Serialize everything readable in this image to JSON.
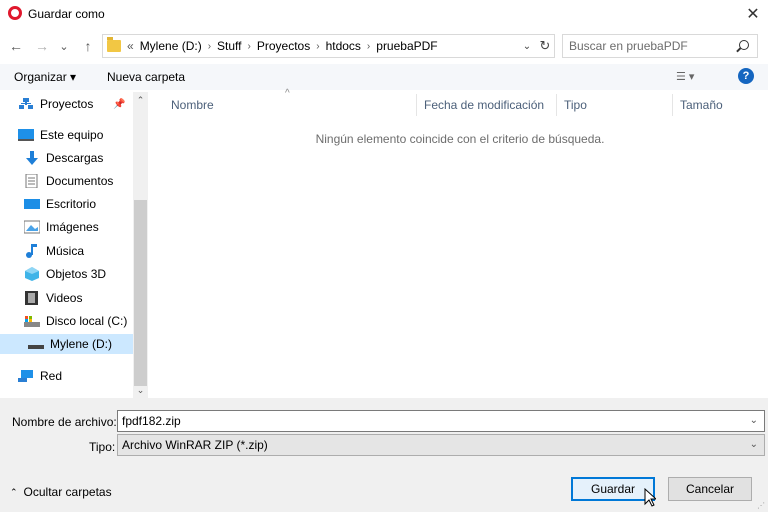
{
  "window": {
    "title": "Guardar como"
  },
  "nav": {
    "back": "←",
    "forward": "→",
    "recent": "⌄",
    "up": "↑"
  },
  "address": {
    "overflow": "«",
    "crumbs": [
      "Mylene (D:)",
      "Stuff",
      "Proyectos",
      "htdocs",
      "pruebaPDF"
    ]
  },
  "search": {
    "placeholder": "Buscar en pruebaPDF"
  },
  "toolbar": {
    "organize": "Organizar ▾",
    "new_folder": "Nueva carpeta",
    "help": "?"
  },
  "sidebar": {
    "items": [
      {
        "label": "Proyectos",
        "icon": "network-folder-icon"
      },
      {
        "label": "Este equipo",
        "icon": "computer-icon"
      },
      {
        "label": "Descargas",
        "icon": "downloads-icon"
      },
      {
        "label": "Documentos",
        "icon": "documents-icon"
      },
      {
        "label": "Escritorio",
        "icon": "desktop-icon"
      },
      {
        "label": "Imágenes",
        "icon": "pictures-icon"
      },
      {
        "label": "Música",
        "icon": "music-icon"
      },
      {
        "label": "Objetos 3D",
        "icon": "objects3d-icon"
      },
      {
        "label": "Videos",
        "icon": "videos-icon"
      },
      {
        "label": "Disco local (C:)",
        "icon": "local-disk-icon"
      },
      {
        "label": "Mylene (D:)",
        "icon": "drive-icon",
        "selected": true
      },
      {
        "label": "Red",
        "icon": "network-icon"
      }
    ]
  },
  "columns": [
    "Nombre",
    "Fecha de modificación",
    "Tipo",
    "Tamaño"
  ],
  "empty_message": "Ningún elemento coincide con el criterio de búsqueda.",
  "form": {
    "filename_label": "Nombre de archivo:",
    "filename_value": "fpdf182.zip",
    "type_label": "Tipo:",
    "type_value": "Archivo WinRAR ZIP (*.zip)"
  },
  "footer": {
    "hide_folders": "Ocultar carpetas",
    "save": "Guardar",
    "cancel": "Cancelar"
  },
  "colors": {
    "accent": "#0078d7",
    "selected": "#cce8ff",
    "brand": "#e0182d"
  }
}
